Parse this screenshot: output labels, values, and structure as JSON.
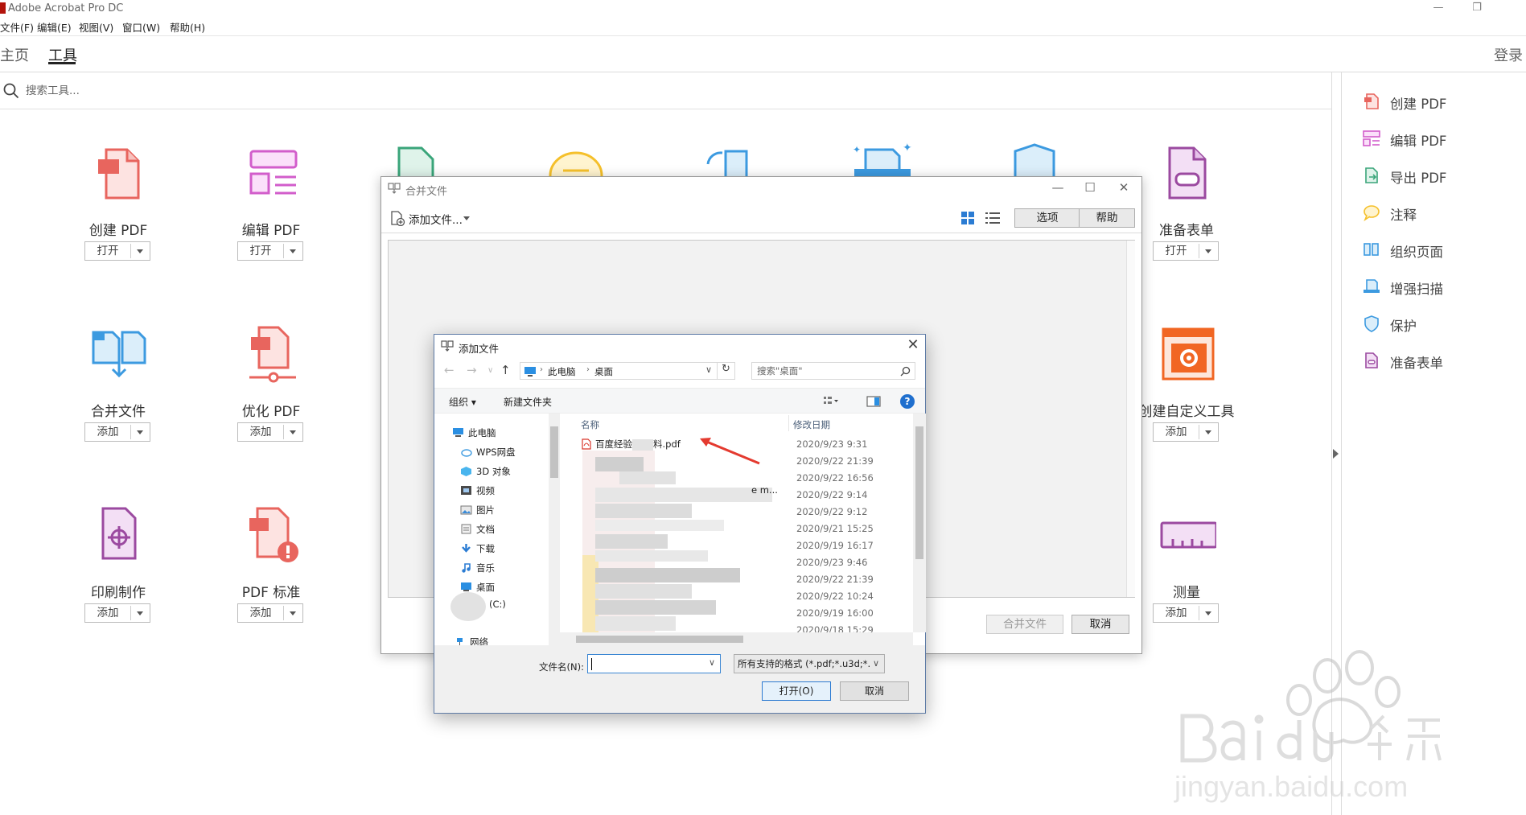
{
  "app": {
    "title": "Adobe Acrobat Pro DC"
  },
  "menu": [
    "文件(F)",
    "编辑(E)",
    "视图(V)",
    "窗口(W)",
    "帮助(H)"
  ],
  "tabs": {
    "home": "主页",
    "tools": "工具",
    "login": "登录"
  },
  "search": {
    "placeholder": "搜索工具..."
  },
  "tools": [
    {
      "label": "创建 PDF",
      "button": "打开"
    },
    {
      "label": "编辑 PDF",
      "button": "打开"
    },
    {
      "label": "准备表单",
      "button": "打开"
    },
    {
      "label": "合并文件",
      "button": "添加"
    },
    {
      "label": "优化 PDF",
      "button": "添加"
    },
    {
      "label": "创建自定义工具",
      "button": "添加"
    },
    {
      "label": "印刷制作",
      "button": "添加"
    },
    {
      "label": "PDF 标准",
      "button": "添加"
    },
    {
      "label": "测量",
      "button": "添加"
    }
  ],
  "right_panel": [
    "创建 PDF",
    "编辑 PDF",
    "导出 PDF",
    "注释",
    "组织页面",
    "增强扫描",
    "保护",
    "准备表单"
  ],
  "merge_dialog": {
    "title": "合并文件",
    "add_files": "添加文件...",
    "options": "选项",
    "help": "帮助",
    "merge_button": "合并文件",
    "cancel": "取消"
  },
  "file_dialog": {
    "title": "添加文件",
    "breadcrumb": [
      "此电脑",
      "桌面"
    ],
    "search_placeholder": "搜索\"桌面\"",
    "organize": "组织",
    "new_folder": "新建文件夹",
    "tree": [
      "此电脑",
      "WPS网盘",
      "3D 对象",
      "视频",
      "图片",
      "文档",
      "下载",
      "音乐",
      "桌面",
      "(C:)",
      "网络"
    ],
    "columns": {
      "name": "名称",
      "date": "修改日期"
    },
    "first_file": "百度经验",
    "first_file_ext": "料.pdf",
    "partial_name": "e m...",
    "dates": [
      "2020/9/23 9:31",
      "2020/9/22 21:39",
      "2020/9/22 16:56",
      "2020/9/22 9:14",
      "2020/9/22 9:12",
      "2020/9/21 15:25",
      "2020/9/19 16:17",
      "2020/9/23 9:46",
      "2020/9/22 21:39",
      "2020/9/22 10:24",
      "2020/9/19 16:00",
      "2020/9/18 15:29"
    ],
    "filename_label": "文件名(N):",
    "filetype": "所有支持的格式 (*.pdf;*.u3d;*.",
    "open": "打开(O)",
    "cancel": "取消"
  },
  "watermark": {
    "brand": "Bai 经验",
    "url": "jingyan.baidu.com"
  },
  "colors": {
    "acrobat_red": "#b3140c",
    "tool_red": "#e8655e",
    "tool_pink": "#d25dcb",
    "tool_blue": "#3c9ae0",
    "tool_green": "#3aa57a",
    "tool_purple": "#9b4aa0",
    "tool_orange": "#f16623"
  }
}
